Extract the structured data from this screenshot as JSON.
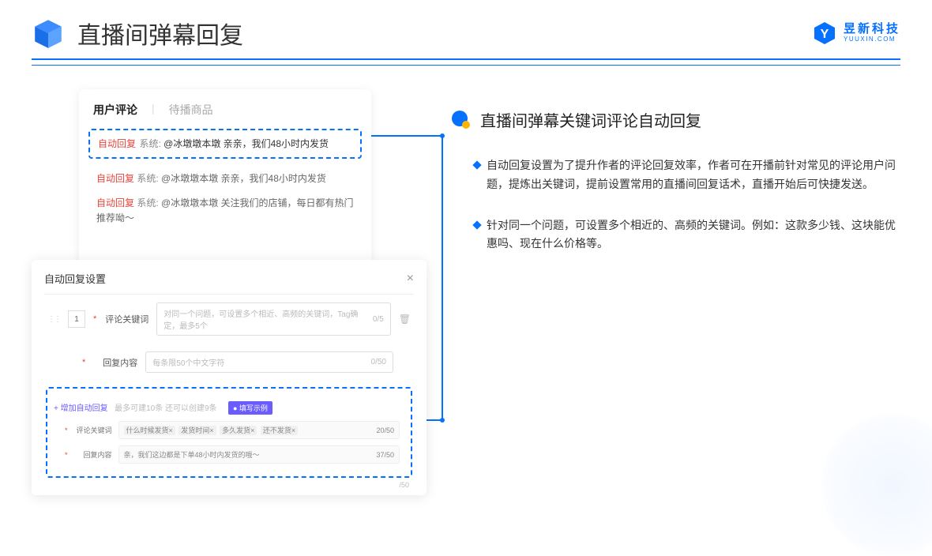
{
  "header": {
    "title": "直播间弹幕回复",
    "brand_cn": "昱新科技",
    "brand_en": "YUUXIN.COM"
  },
  "comments": {
    "tab_active": "用户评论",
    "tab_inactive": "待播商品",
    "highlighted": {
      "tag": "自动回复",
      "sys": "系统: ",
      "msg": "@冰墩墩本墩 亲亲，我们48小时内发货"
    },
    "row2": {
      "tag": "自动回复",
      "sys": "系统: ",
      "msg": "@冰墩墩本墩 亲亲，我们48小时内发货"
    },
    "row3": {
      "tag": "自动回复",
      "sys": "系统: ",
      "msg": "@冰墩墩本墩 关注我们的店铺，每日都有热门推荐呦～"
    }
  },
  "settings": {
    "title": "自动回复设置",
    "idx": "1",
    "label_keyword": "评论关键词",
    "placeholder_keyword": "对同一个问题，可设置多个相近、高频的关键词，Tag确定，最多5个",
    "count_keyword": "0/5",
    "label_content": "回复内容",
    "placeholder_content": "每条限50个中文字符",
    "count_content": "0/50",
    "add_link": "+ 增加自动回复",
    "add_note": "最多可建10条 还可以创建9条",
    "ex_badge": "● 填写示例",
    "ex_label_kw": "评论关键词",
    "ex_kw_tags": [
      "什么时候发货×",
      "发货时间×",
      "多久发货×",
      "还不发货×"
    ],
    "ex_kw_count": "20/50",
    "ex_label_ct": "回复内容",
    "ex_ct_text": "亲，我们这边都是下单48小时内发货的哦～",
    "ex_ct_count": "37/50",
    "below_count": "/50"
  },
  "right": {
    "section_title": "直播间弹幕关键词评论自动回复",
    "bullet1": "自动回复设置为了提升作者的评论回复效率，作者可在开播前针对常见的评论用户问题，提炼出关键词，提前设置常用的直播间回复话术，直播开始后可快捷发送。",
    "bullet2": "针对同一个问题，可设置多个相近的、高频的关键词。例如：这款多少钱、这块能优惠吗、现在什么价格等。"
  }
}
